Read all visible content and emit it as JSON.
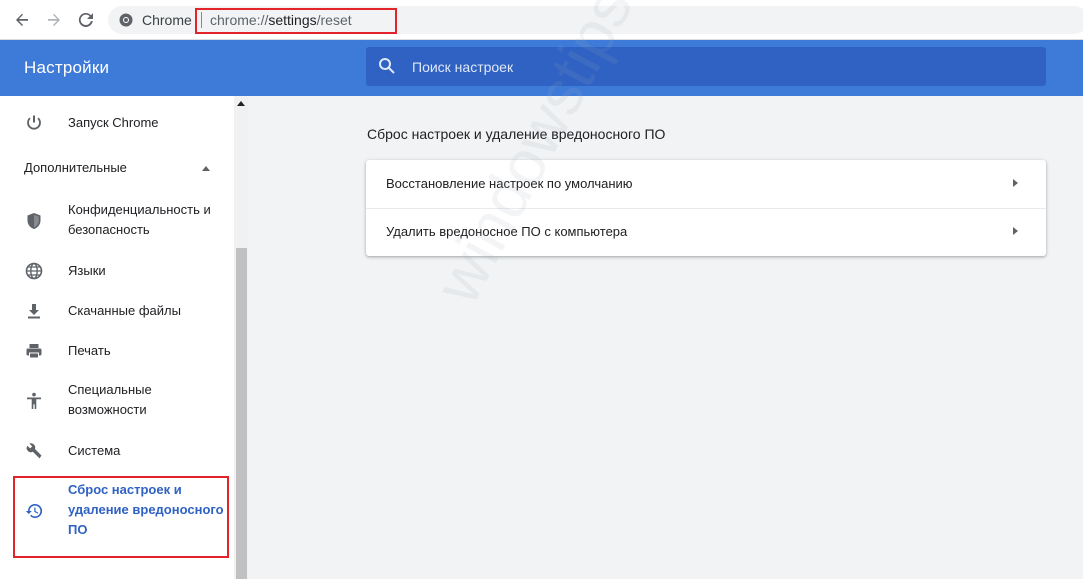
{
  "toolbar": {
    "site_chip": "Chrome",
    "url_scheme": "chrome://",
    "url_host": "settings",
    "url_path": "/reset"
  },
  "header": {
    "title": "Настройки",
    "search_placeholder": "Поиск настроек"
  },
  "sidebar": {
    "items": [
      {
        "label": "Запуск Chrome",
        "icon": "power-icon"
      },
      {
        "label": "Конфиденциальность и безопасность",
        "icon": "shield-icon"
      },
      {
        "label": "Языки",
        "icon": "globe-icon"
      },
      {
        "label": "Скачанные файлы",
        "icon": "download-icon"
      },
      {
        "label": "Печать",
        "icon": "printer-icon"
      },
      {
        "label": "Специальные возможности",
        "icon": "accessibility-icon"
      },
      {
        "label": "Система",
        "icon": "wrench-icon"
      },
      {
        "label": "Сброс настроек и удаление вредоносного ПО",
        "icon": "restore-icon"
      }
    ],
    "advanced_label": "Дополнительные"
  },
  "main": {
    "section_title": "Сброс настроек и удаление вредоносного ПО",
    "rows": [
      {
        "label": "Восстановление настроек по умолчанию"
      },
      {
        "label": "Удалить вредоносное ПО с компьютера"
      }
    ]
  },
  "watermark": "windowstips.ru",
  "colors": {
    "header_bg": "#3e7bd8",
    "search_bg": "#2f62c3",
    "active_text": "#2f62c3",
    "highlight_border": "#e2232a"
  }
}
